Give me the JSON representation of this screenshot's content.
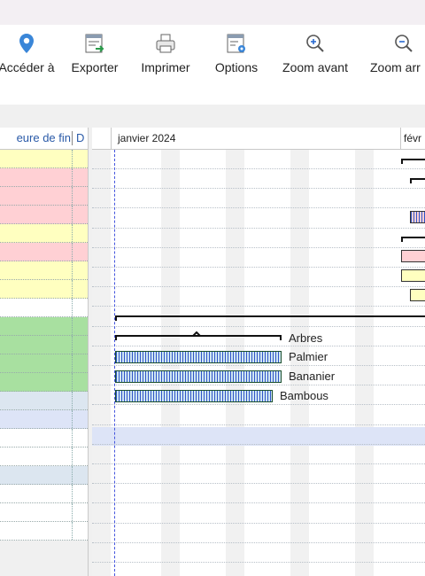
{
  "toolbar": {
    "buttons": [
      {
        "label": "Accéder à",
        "icon": "location-pin-icon"
      },
      {
        "label": "Exporter",
        "icon": "export-icon"
      },
      {
        "label": "Imprimer",
        "icon": "printer-icon"
      },
      {
        "label": "Options",
        "icon": "options-icon"
      },
      {
        "label": "Zoom avant",
        "icon": "zoom-in-icon"
      },
      {
        "label": "Zoom arr",
        "icon": "zoom-out-icon"
      }
    ]
  },
  "grid": {
    "header_end": "eure de fin",
    "header_d": "D",
    "row_colors": [
      "#ffffc0",
      "#ffd0d4",
      "#ffd0d4",
      "#ffd0d4",
      "#ffffc0",
      "#ffd0d4",
      "#ffffc0",
      "#ffffc0",
      "#ffffff",
      "#a8e0a0",
      "#a8e0a0",
      "#a8e0a0",
      "#a8e0a0",
      "#dce6f0",
      "#dde4f7",
      "#ffffff",
      "#ffffff",
      "#dce6f0",
      "#ffffff",
      "#ffffff",
      "#ffffff"
    ]
  },
  "gantt": {
    "month1": "janvier 2024",
    "month2": "févr",
    "tasks": [
      {
        "label": "Arbres"
      },
      {
        "label": "Palmier"
      },
      {
        "label": "Bananier"
      },
      {
        "label": "Bambous"
      }
    ]
  },
  "colors": {
    "bar_fill": "#cfe6f2",
    "bar_stripe": "#2f55c8",
    "today_line": "#4455dd"
  }
}
